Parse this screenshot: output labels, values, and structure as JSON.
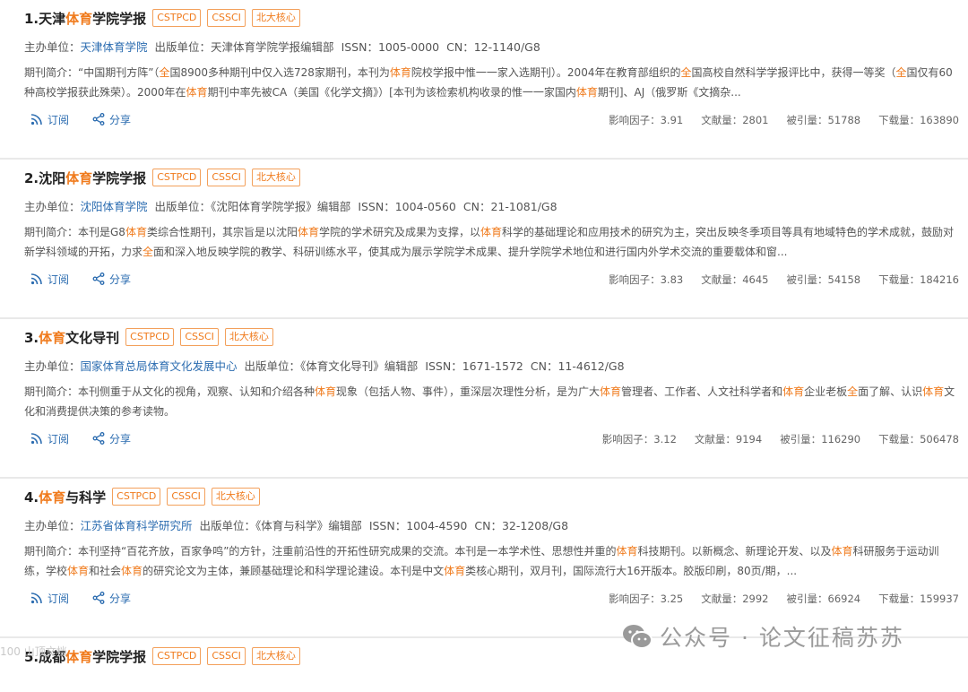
{
  "labels": {
    "sponsor": "主办单位：",
    "publisher": "出版单位：",
    "issn": "ISSN：",
    "cn": "CN：",
    "intro": "期刊简介：",
    "subscribe": "订阅",
    "share": "分享",
    "impact": "影响因子：",
    "docs": "文献量：",
    "cited": "被引量：",
    "downloads": "下载量："
  },
  "journals": [
    {
      "index": "1.",
      "title_pre": "天津",
      "title_hl": "体育",
      "title_post": "学院学报",
      "badges": [
        "CSTPCD",
        "CSSCI",
        "北大核心"
      ],
      "sponsor": "天津体育学院",
      "publisher": "天津体育学院学报编辑部",
      "issn": "1005-0000",
      "cn": "12-1140/G8",
      "intro_segments": [
        {
          "t": "期刊简介：“中国期刊方阵”（",
          "h": false
        },
        {
          "t": "全",
          "h": true
        },
        {
          "t": "国8900多种期刊中仅入选728家期刊，本刊为",
          "h": false
        },
        {
          "t": "体育",
          "h": true
        },
        {
          "t": "院校学报中惟一一家入选期刊）。2004年在教育部组织的",
          "h": false
        },
        {
          "t": "全",
          "h": true
        },
        {
          "t": "国高校自然科学学报评比中，获得一等奖（",
          "h": false
        },
        {
          "t": "全",
          "h": true
        },
        {
          "t": "国仅有60种高校学报获此殊荣）。2000年在",
          "h": false
        },
        {
          "t": "体育",
          "h": true
        },
        {
          "t": "期刊中率先被CA（美国《化学文摘》）[本刊为该检索机构收录的惟一一家国内",
          "h": false
        },
        {
          "t": "体育",
          "h": true
        },
        {
          "t": "期刊]、AJ（俄罗斯《文摘杂...",
          "h": false
        }
      ],
      "impact": "3.91",
      "docs": "2801",
      "cited": "51788",
      "downloads": "163890"
    },
    {
      "index": "2.",
      "title_pre": "沈阳",
      "title_hl": "体育",
      "title_post": "学院学报",
      "badges": [
        "CSTPCD",
        "CSSCI",
        "北大核心"
      ],
      "sponsor": "沈阳体育学院",
      "publisher": "《沈阳体育学院学报》编辑部",
      "issn": "1004-0560",
      "cn": "21-1081/G8",
      "intro_segments": [
        {
          "t": "期刊简介：本刊是G8",
          "h": false
        },
        {
          "t": "体育",
          "h": true
        },
        {
          "t": "类综合性期刊，其宗旨是以沈阳",
          "h": false
        },
        {
          "t": "体育",
          "h": true
        },
        {
          "t": "学院的学术研究及成果为支撑，以",
          "h": false
        },
        {
          "t": "体育",
          "h": true
        },
        {
          "t": "科学的基础理论和应用技术的研究为主，突出反映冬季项目等具有地域特色的学术成就，鼓励对新学科领域的开拓，力求",
          "h": false
        },
        {
          "t": "全",
          "h": true
        },
        {
          "t": "面和深入地反映学院的教学、科研训练水平，使其成为展示学院学术成果、提升学院学术地位和进行国内外学术交流的重要载体和窗...",
          "h": false
        }
      ],
      "impact": "3.83",
      "docs": "4645",
      "cited": "54158",
      "downloads": "184216"
    },
    {
      "index": "3.",
      "title_pre": "",
      "title_hl": "体育",
      "title_post": "文化导刊",
      "badges": [
        "CSTPCD",
        "CSSCI",
        "北大核心"
      ],
      "sponsor": "国家体育总局体育文化发展中心",
      "publisher": "《体育文化导刊》编辑部",
      "issn": "1671-1572",
      "cn": "11-4612/G8",
      "intro_segments": [
        {
          "t": "期刊简介：本刊侧重于从文化的视角，观察、认知和介绍各种",
          "h": false
        },
        {
          "t": "体育",
          "h": true
        },
        {
          "t": "现象（包括人物、事件），重深层次理性分析，是为广大",
          "h": false
        },
        {
          "t": "体育",
          "h": true
        },
        {
          "t": "管理者、工作者、人文社科学者和",
          "h": false
        },
        {
          "t": "体育",
          "h": true
        },
        {
          "t": "企业老板",
          "h": false
        },
        {
          "t": "全",
          "h": true
        },
        {
          "t": "面了解、认识",
          "h": false
        },
        {
          "t": "体育",
          "h": true
        },
        {
          "t": "文化和消费提供决策的参考读物。",
          "h": false
        }
      ],
      "impact": "3.12",
      "docs": "9194",
      "cited": "116290",
      "downloads": "506478"
    },
    {
      "index": "4.",
      "title_pre": "",
      "title_hl": "体育",
      "title_post": "与科学",
      "badges": [
        "CSTPCD",
        "CSSCI",
        "北大核心"
      ],
      "sponsor": "江苏省体育科学研究所",
      "publisher": "《体育与科学》编辑部",
      "issn": "1004-4590",
      "cn": "32-1208/G8",
      "intro_segments": [
        {
          "t": "期刊简介：本刊坚持“百花齐放，百家争鸣”的方针，注重前沿性的开拓性研究成果的交流。本刊是一本学术性、思想性并重的",
          "h": false
        },
        {
          "t": "体育",
          "h": true
        },
        {
          "t": "科技期刊。以新概念、新理论开发、以及",
          "h": false
        },
        {
          "t": "体育",
          "h": true
        },
        {
          "t": "科研服务于运动训练，学校",
          "h": false
        },
        {
          "t": "体育",
          "h": true
        },
        {
          "t": "和社会",
          "h": false
        },
        {
          "t": "体育",
          "h": true
        },
        {
          "t": "的研究论文为主体，兼顾基础理论和科学理论建设。本刊是中文",
          "h": false
        },
        {
          "t": "体育",
          "h": true
        },
        {
          "t": "类核心期刊，双月刊，国际流行大16开版本。胶版印刷，80页/期，...",
          "h": false
        }
      ],
      "impact": "3.25",
      "docs": "2992",
      "cited": "66924",
      "downloads": "159937"
    }
  ],
  "partial": {
    "index": "5.",
    "title_pre": "成都",
    "title_hl": "体育",
    "title_post": "学院学报",
    "badges": [
      "CSTPCD",
      "CSSCI",
      "北大核心"
    ]
  },
  "watermark": "公众号 · 论文征稿苏苏",
  "corner_text": "100 山顶文档",
  "colors": {
    "accent": "#f07b1d",
    "link": "#2b6cb0"
  }
}
